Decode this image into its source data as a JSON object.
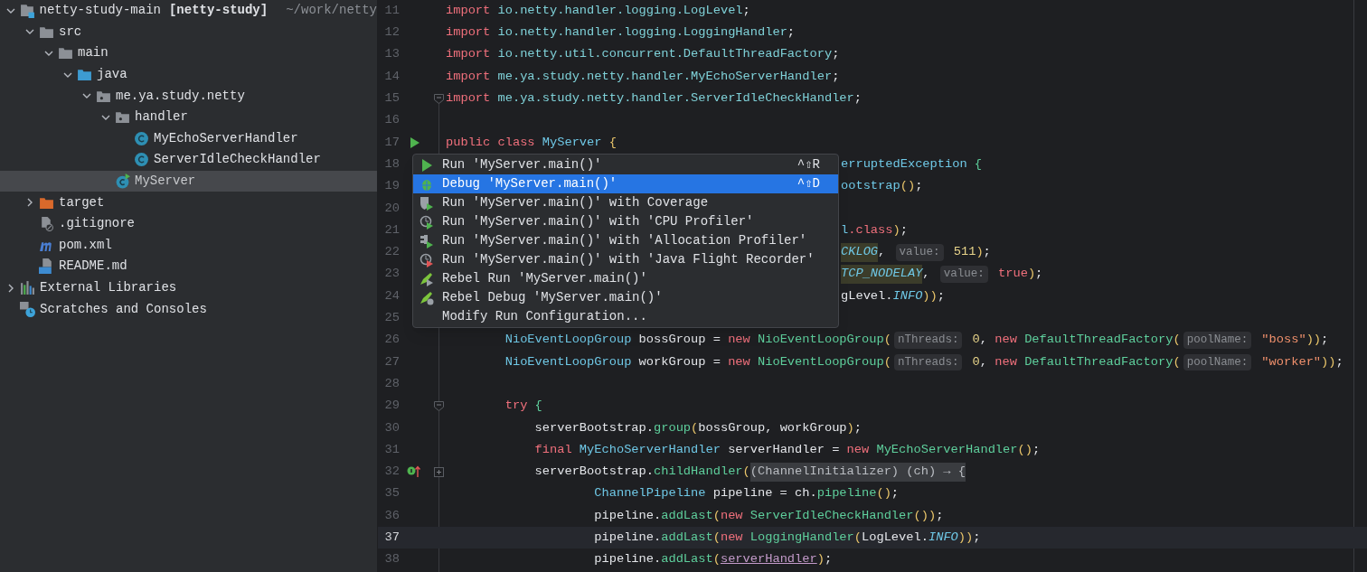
{
  "project_tree": {
    "items": [
      {
        "kind": "module",
        "label": "netty-study-main",
        "module": "[netty-study]",
        "path": "~/work/netty",
        "expanded": true,
        "selected": false,
        "children": [
          {
            "kind": "folder",
            "label": "src",
            "expanded": true,
            "selected": false,
            "children": [
              {
                "kind": "folder",
                "label": "main",
                "expanded": true,
                "selected": false,
                "children": [
                  {
                    "kind": "source-folder",
                    "label": "java",
                    "expanded": true,
                    "selected": false,
                    "children": [
                      {
                        "kind": "package",
                        "label": "me.ya.study.netty",
                        "expanded": true,
                        "selected": false,
                        "children": [
                          {
                            "kind": "package",
                            "label": "handler",
                            "expanded": true,
                            "selected": false,
                            "children": [
                              {
                                "kind": "class",
                                "label": "MyEchoServerHandler",
                                "selected": false
                              },
                              {
                                "kind": "class",
                                "label": "ServerIdleCheckHandler",
                                "selected": false
                              }
                            ]
                          },
                          {
                            "kind": "runnable-class",
                            "label": "MyServer",
                            "selected": true
                          }
                        ]
                      }
                    ]
                  }
                ]
              }
            ]
          },
          {
            "kind": "excluded-folder",
            "label": "target",
            "expanded": false,
            "selected": false
          },
          {
            "kind": "ignore-file",
            "label": ".gitignore",
            "selected": false
          },
          {
            "kind": "maven-file",
            "label": "pom.xml",
            "selected": false
          },
          {
            "kind": "markdown-file",
            "label": "README.md",
            "selected": false
          }
        ]
      },
      {
        "kind": "libraries",
        "label": "External Libraries",
        "expanded": false,
        "selected": false
      },
      {
        "kind": "scratches",
        "label": "Scratches and Consoles",
        "selected": false
      }
    ]
  },
  "editor": {
    "lines": [
      {
        "number": "11",
        "current": false,
        "covered": false,
        "tokens": [
          {
            "kind": "kw",
            "text": "import"
          },
          {
            "kind": "pkg",
            "text": " io.netty.handler.logging.LogLevel"
          },
          {
            "kind": "plain",
            "text": ";"
          }
        ]
      },
      {
        "number": "12",
        "current": false,
        "covered": false,
        "tokens": [
          {
            "kind": "kw",
            "text": "import"
          },
          {
            "kind": "pkg",
            "text": " io.netty.handler.logging.LoggingHandler"
          },
          {
            "kind": "plain",
            "text": ";"
          }
        ]
      },
      {
        "number": "13",
        "current": false,
        "covered": false,
        "tokens": [
          {
            "kind": "kw",
            "text": "import"
          },
          {
            "kind": "pkg",
            "text": " io.netty.util.concurrent.DefaultThreadFactory"
          },
          {
            "kind": "plain",
            "text": ";"
          }
        ]
      },
      {
        "number": "14",
        "current": false,
        "covered": false,
        "tokens": [
          {
            "kind": "kw",
            "text": "import"
          },
          {
            "kind": "pkg",
            "text": " me.ya.study.netty.handler.MyEchoServerHandler"
          },
          {
            "kind": "plain",
            "text": ";"
          }
        ]
      },
      {
        "number": "15",
        "current": false,
        "covered": false,
        "gutter": [
          {
            "kind": "fold"
          }
        ],
        "tokens": [
          {
            "kind": "kw",
            "text": "import"
          },
          {
            "kind": "pkg",
            "text": " me.ya.study.netty.handler.ServerIdleCheckHandler"
          },
          {
            "kind": "plain",
            "text": ";"
          }
        ]
      },
      {
        "number": "16",
        "current": false
      },
      {
        "number": "17",
        "current": false,
        "covered": false,
        "gutter": [
          {
            "kind": "run"
          }
        ],
        "tokens": [
          {
            "kind": "kw",
            "text": "public class"
          },
          {
            "kind": "type",
            "text": " MyServer"
          },
          {
            "kind": "paren",
            "text": " {"
          }
        ]
      },
      {
        "number": "18",
        "current": false,
        "covered": true,
        "tokens": [
          {
            "kind": "type",
            "text": "erruptedException"
          },
          {
            "kind": "brace",
            "text": " {"
          }
        ]
      },
      {
        "number": "19",
        "current": false,
        "covered": true,
        "tokens": [
          {
            "kind": "type",
            "text": "ootstrap"
          },
          {
            "kind": "paren",
            "text": "()"
          },
          {
            "kind": "plain",
            "text": ";"
          }
        ]
      },
      {
        "number": "20",
        "current": false
      },
      {
        "number": "21",
        "current": false,
        "covered": true,
        "tokens": [
          {
            "kind": "type",
            "text": "l"
          },
          {
            "kind": "kw",
            "text": ".class"
          },
          {
            "kind": "paren",
            "text": ")"
          },
          {
            "kind": "plain",
            "text": ";"
          }
        ]
      },
      {
        "number": "22",
        "current": false,
        "covered": true,
        "tokens": [
          {
            "kind": "const-hl",
            "text": "CKLOG"
          },
          {
            "kind": "plain",
            "text": ", "
          },
          {
            "kind": "hint",
            "text": "value:"
          },
          {
            "kind": "num",
            "text": " 511"
          },
          {
            "kind": "paren",
            "text": ")"
          },
          {
            "kind": "plain",
            "text": ";"
          }
        ]
      },
      {
        "number": "23",
        "current": false,
        "covered": true,
        "tokens": [
          {
            "kind": "const-hl",
            "text": "TCP_NODELAY"
          },
          {
            "kind": "plain",
            "text": ", "
          },
          {
            "kind": "hint",
            "text": "value:"
          },
          {
            "kind": "kw",
            "text": " true"
          },
          {
            "kind": "paren",
            "text": ")"
          },
          {
            "kind": "plain",
            "text": ";"
          }
        ]
      },
      {
        "number": "24",
        "current": false,
        "covered": true,
        "tokens": [
          {
            "kind": "plain",
            "text": "gLevel."
          },
          {
            "kind": "const",
            "text": "INFO"
          },
          {
            "kind": "paren",
            "text": "))"
          },
          {
            "kind": "plain",
            "text": ";"
          }
        ]
      },
      {
        "number": "25",
        "current": false
      },
      {
        "number": "26",
        "current": false,
        "covered": false,
        "tokens": [
          {
            "kind": "type",
            "text": "        NioEventLoopGroup"
          },
          {
            "kind": "plain",
            "text": " bossGroup = "
          },
          {
            "kind": "kw",
            "text": "new"
          },
          {
            "kind": "call",
            "text": " NioEventLoopGroup"
          },
          {
            "kind": "paren",
            "text": "("
          },
          {
            "kind": "hint",
            "text": "nThreads:"
          },
          {
            "kind": "num",
            "text": " 0"
          },
          {
            "kind": "plain",
            "text": ", "
          },
          {
            "kind": "kw",
            "text": "new"
          },
          {
            "kind": "call",
            "text": " DefaultThreadFactory"
          },
          {
            "kind": "paren",
            "text": "("
          },
          {
            "kind": "hint",
            "text": "poolName:"
          },
          {
            "kind": "str",
            "text": " \"boss\""
          },
          {
            "kind": "paren",
            "text": "))"
          },
          {
            "kind": "plain",
            "text": ";"
          }
        ]
      },
      {
        "number": "27",
        "current": false,
        "covered": false,
        "tokens": [
          {
            "kind": "type",
            "text": "        NioEventLoopGroup"
          },
          {
            "kind": "plain",
            "text": " workGroup = "
          },
          {
            "kind": "kw",
            "text": "new"
          },
          {
            "kind": "call",
            "text": " NioEventLoopGroup"
          },
          {
            "kind": "paren",
            "text": "("
          },
          {
            "kind": "hint",
            "text": "nThreads:"
          },
          {
            "kind": "num",
            "text": " 0"
          },
          {
            "kind": "plain",
            "text": ", "
          },
          {
            "kind": "kw",
            "text": "new"
          },
          {
            "kind": "call",
            "text": " DefaultThreadFactory"
          },
          {
            "kind": "paren",
            "text": "("
          },
          {
            "kind": "hint",
            "text": "poolName:"
          },
          {
            "kind": "str",
            "text": " \"worker\""
          },
          {
            "kind": "paren",
            "text": "))"
          },
          {
            "kind": "plain",
            "text": ";"
          }
        ]
      },
      {
        "number": "28",
        "current": false
      },
      {
        "number": "29",
        "current": false,
        "covered": false,
        "gutter": [
          {
            "kind": "fold"
          }
        ],
        "tokens": [
          {
            "kind": "kw",
            "text": "        try"
          },
          {
            "kind": "brace",
            "text": " {"
          }
        ]
      },
      {
        "number": "30",
        "current": false,
        "covered": false,
        "tokens": [
          {
            "kind": "plain",
            "text": "            serverBootstrap."
          },
          {
            "kind": "call",
            "text": "group"
          },
          {
            "kind": "paren",
            "text": "("
          },
          {
            "kind": "plain",
            "text": "bossGroup, workGroup"
          },
          {
            "kind": "paren",
            "text": ")"
          },
          {
            "kind": "plain",
            "text": ";"
          }
        ]
      },
      {
        "number": "31",
        "current": false,
        "covered": false,
        "tokens": [
          {
            "kind": "kw",
            "text": "            final"
          },
          {
            "kind": "type",
            "text": " MyEchoServerHandler"
          },
          {
            "kind": "plain",
            "text": " serverHandler = "
          },
          {
            "kind": "kw",
            "text": "new"
          },
          {
            "kind": "call",
            "text": " MyEchoServerHandler"
          },
          {
            "kind": "paren",
            "text": "()"
          },
          {
            "kind": "plain",
            "text": ";"
          }
        ]
      },
      {
        "number": "32",
        "current": false,
        "covered": false,
        "gutter": [
          {
            "kind": "implements"
          },
          {
            "kind": "expand"
          }
        ],
        "tokens": [
          {
            "kind": "plain",
            "text": "            serverBootstrap."
          },
          {
            "kind": "call",
            "text": "childHandler"
          },
          {
            "kind": "paren",
            "text": "("
          },
          {
            "kind": "folded",
            "text": "(ChannelInitializer) (ch) → {"
          }
        ]
      },
      {
        "number": "35",
        "current": false,
        "covered": false,
        "tokens": [
          {
            "kind": "type",
            "text": "                    ChannelPipeline"
          },
          {
            "kind": "plain",
            "text": " pipeline = ch."
          },
          {
            "kind": "call",
            "text": "pipeline"
          },
          {
            "kind": "paren",
            "text": "()"
          },
          {
            "kind": "plain",
            "text": ";"
          }
        ]
      },
      {
        "number": "36",
        "current": false,
        "covered": false,
        "tokens": [
          {
            "kind": "plain",
            "text": "                    pipeline."
          },
          {
            "kind": "call",
            "text": "addLast"
          },
          {
            "kind": "paren",
            "text": "("
          },
          {
            "kind": "kw",
            "text": "new"
          },
          {
            "kind": "call",
            "text": " ServerIdleCheckHandler"
          },
          {
            "kind": "paren",
            "text": "())"
          },
          {
            "kind": "plain",
            "text": ";"
          }
        ]
      },
      {
        "number": "37",
        "current": true,
        "covered": false,
        "tokens": [
          {
            "kind": "plain",
            "text": "                    pipeline."
          },
          {
            "kind": "call",
            "text": "addLast"
          },
          {
            "kind": "paren",
            "text": "("
          },
          {
            "kind": "kw",
            "text": "new"
          },
          {
            "kind": "call",
            "text": " LoggingHandler"
          },
          {
            "kind": "paren",
            "text": "("
          },
          {
            "kind": "plain",
            "text": "LogLevel."
          },
          {
            "kind": "const",
            "text": "INFO"
          },
          {
            "kind": "paren",
            "text": "))"
          },
          {
            "kind": "plain",
            "text": ";"
          }
        ]
      },
      {
        "number": "38",
        "current": false,
        "covered": false,
        "tokens": [
          {
            "kind": "plain",
            "text": "                    pipeline."
          },
          {
            "kind": "call",
            "text": "addLast"
          },
          {
            "kind": "paren",
            "text": "("
          },
          {
            "kind": "link",
            "text": "serverHandler"
          },
          {
            "kind": "paren",
            "text": ")"
          },
          {
            "kind": "plain",
            "text": ";"
          }
        ]
      }
    ]
  },
  "context_menu": {
    "items": [
      {
        "kind": "run",
        "label": "Run 'MyServer.main()'",
        "shortcut": "^⇧R",
        "selected": false
      },
      {
        "kind": "debug",
        "label": "Debug 'MyServer.main()'",
        "shortcut": "^⇧D",
        "selected": true
      },
      {
        "kind": "coverage",
        "label": "Run 'MyServer.main()' with Coverage",
        "selected": false
      },
      {
        "kind": "cpu-profiler",
        "label": "Run 'MyServer.main()' with 'CPU Profiler'",
        "selected": false
      },
      {
        "kind": "allocation-profiler",
        "label": "Run 'MyServer.main()' with 'Allocation Profiler'",
        "selected": false
      },
      {
        "kind": "flight-recorder",
        "label": "Run 'MyServer.main()' with 'Java Flight Recorder'",
        "selected": false
      },
      {
        "kind": "rebel-run",
        "label": "Rebel Run 'MyServer.main()'",
        "selected": false
      },
      {
        "kind": "rebel-debug",
        "label": "Rebel Debug 'MyServer.main()'",
        "selected": false
      },
      {
        "kind": "none",
        "label": "Modify Run Configuration...",
        "selected": false
      }
    ]
  }
}
